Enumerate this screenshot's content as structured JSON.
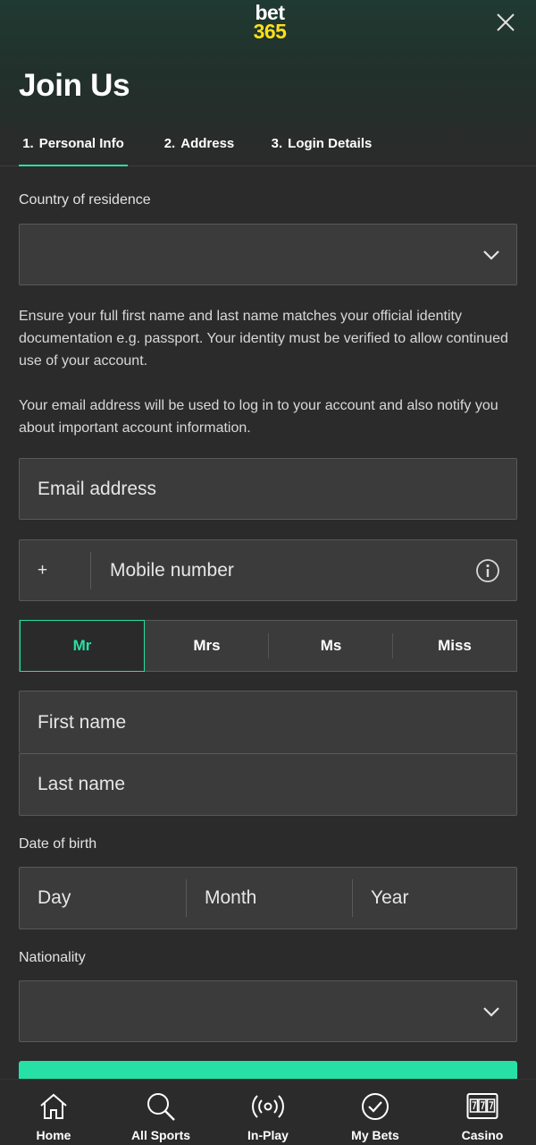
{
  "header": {
    "logo_top": "bet",
    "logo_bottom": "365",
    "title": "Join Us",
    "close_icon": "close-icon"
  },
  "tabs": [
    {
      "num": "1.",
      "label": "Personal Info",
      "active": true
    },
    {
      "num": "2.",
      "label": "Address",
      "active": false
    },
    {
      "num": "3.",
      "label": "Login Details",
      "active": false
    }
  ],
  "form": {
    "country_label": "Country of residence",
    "country_value": "",
    "identity_note": "Ensure your full first name and last name matches your official identity documentation e.g. passport. Your identity must be verified to allow continued use of your account.",
    "email_note": "Your email address will be used to log in to your account and also notify you about important account information.",
    "email_placeholder": "Email address",
    "phone_prefix": "+",
    "mobile_placeholder": "Mobile number",
    "titles": [
      "Mr",
      "Mrs",
      "Ms",
      "Miss"
    ],
    "selected_title": "Mr",
    "first_name_placeholder": "First name",
    "last_name_placeholder": "Last name",
    "dob_label": "Date of birth",
    "dob": {
      "day": "Day",
      "month": "Month",
      "year": "Year"
    },
    "nationality_label": "Nationality",
    "nationality_value": ""
  },
  "bottom_nav": [
    {
      "label": "Home",
      "icon": "home-icon"
    },
    {
      "label": "All Sports",
      "icon": "search-icon"
    },
    {
      "label": "In-Play",
      "icon": "broadcast-icon"
    },
    {
      "label": "My Bets",
      "icon": "check-circle-icon"
    },
    {
      "label": "Casino",
      "icon": "slot-machine-icon"
    }
  ],
  "colors": {
    "accent": "#26e0a6",
    "logo_yellow": "#ffdf1b",
    "background": "#2b2b2b",
    "field": "#3b3b3b"
  }
}
